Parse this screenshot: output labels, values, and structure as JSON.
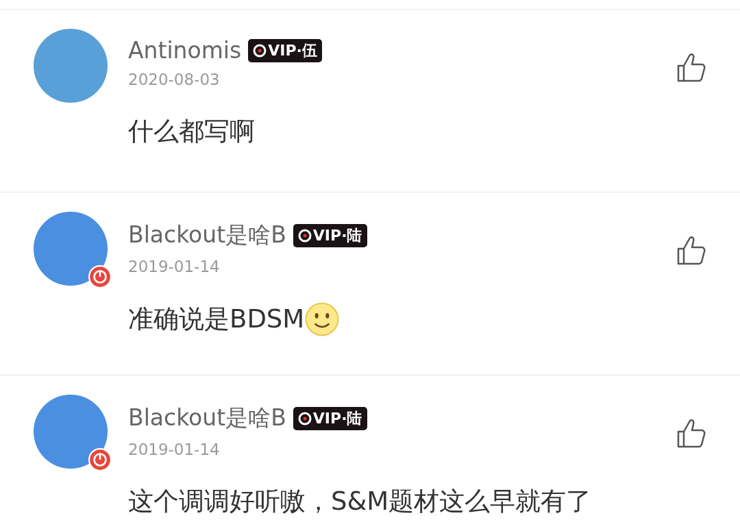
{
  "comments": [
    {
      "username": "Antinomis",
      "vip_label": "VIP·伍",
      "date": "2020-08-03",
      "text": "什么都写啊",
      "smiley": false,
      "avatar_badge": false
    },
    {
      "username": "Blackout是啥B",
      "vip_label": "VIP·陆",
      "date": "2019-01-14",
      "text": "准确说是BDSM",
      "smiley": true,
      "avatar_badge": true
    },
    {
      "username": "Blackout是啥B",
      "vip_label": "VIP·陆",
      "date": "2019-01-14",
      "text": "这个调调好听嗷，S&M题材这么早就有了",
      "smiley": false,
      "avatar_badge": true
    }
  ]
}
